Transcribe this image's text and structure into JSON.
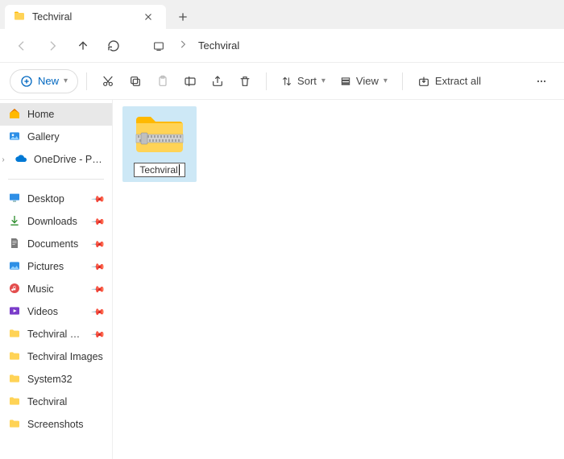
{
  "tab": {
    "title": "Techviral"
  },
  "breadcrumb": {
    "current": "Techviral"
  },
  "toolbar": {
    "new": "New",
    "sort": "Sort",
    "view": "View",
    "extract": "Extract all"
  },
  "nav": {
    "home": "Home",
    "gallery": "Gallery",
    "onedrive": "OneDrive - Personal",
    "quick": [
      {
        "label": "Desktop"
      },
      {
        "label": "Downloads"
      },
      {
        "label": "Documents"
      },
      {
        "label": "Pictures"
      },
      {
        "label": "Music"
      },
      {
        "label": "Videos"
      },
      {
        "label": "Techviral Documents"
      },
      {
        "label": "Techviral Images"
      },
      {
        "label": "System32"
      },
      {
        "label": "Techviral"
      },
      {
        "label": "Screenshots"
      }
    ]
  },
  "file": {
    "name": "Techviral"
  }
}
